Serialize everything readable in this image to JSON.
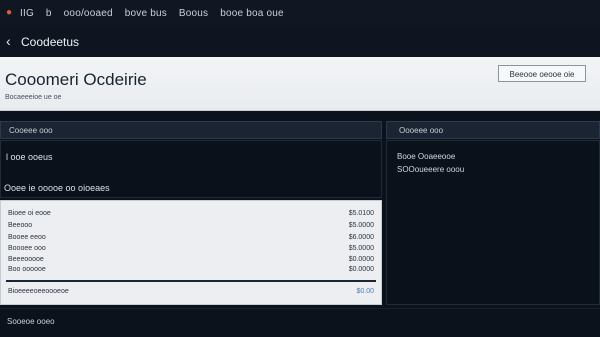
{
  "menubar": {
    "items": [
      "IIG",
      "b",
      "ooo/ooaed",
      "bove bus",
      "Boous",
      "booe boa oue"
    ]
  },
  "app": {
    "title": "Coodeetus"
  },
  "header": {
    "title": "Cooomeri Ocdeirie",
    "subtitle": "Bocaeeeioe ue oe",
    "button_label": "Beeooe oeooe oie"
  },
  "left_panel": {
    "heading": "Cooeee ooo",
    "item1": "l ooe ooeus",
    "item2": "Ooee ie ooooe oo oioeaes"
  },
  "right_panel": {
    "heading": "Oooeee ooo",
    "line1": "Booe Ooaeeooe",
    "line2": "SOOoueeere ooou"
  },
  "summary": {
    "rows": [
      {
        "label": "Bioee oi eooe",
        "value": "$5.0100"
      },
      {
        "label": "Beeooo",
        "value": "$5.0000"
      },
      {
        "label": "Booee eeoo",
        "value": "$6.0000"
      },
      {
        "label": "Boooee ooo",
        "value": "$5.0000"
      },
      {
        "label": "Beeeooooe",
        "value": "$0.0000"
      },
      {
        "label": "Boo oooooe",
        "value": "$0.0000"
      }
    ],
    "total_label": "Bioeeeeoeeoooeoe",
    "total_value": "$0.00"
  },
  "footer": {
    "text": "Sooeoe ooeo"
  },
  "colors": {
    "brand_accent": "#e35a3c",
    "link_blue": "#4e7fb1",
    "dark_bg": "#0c121b"
  }
}
